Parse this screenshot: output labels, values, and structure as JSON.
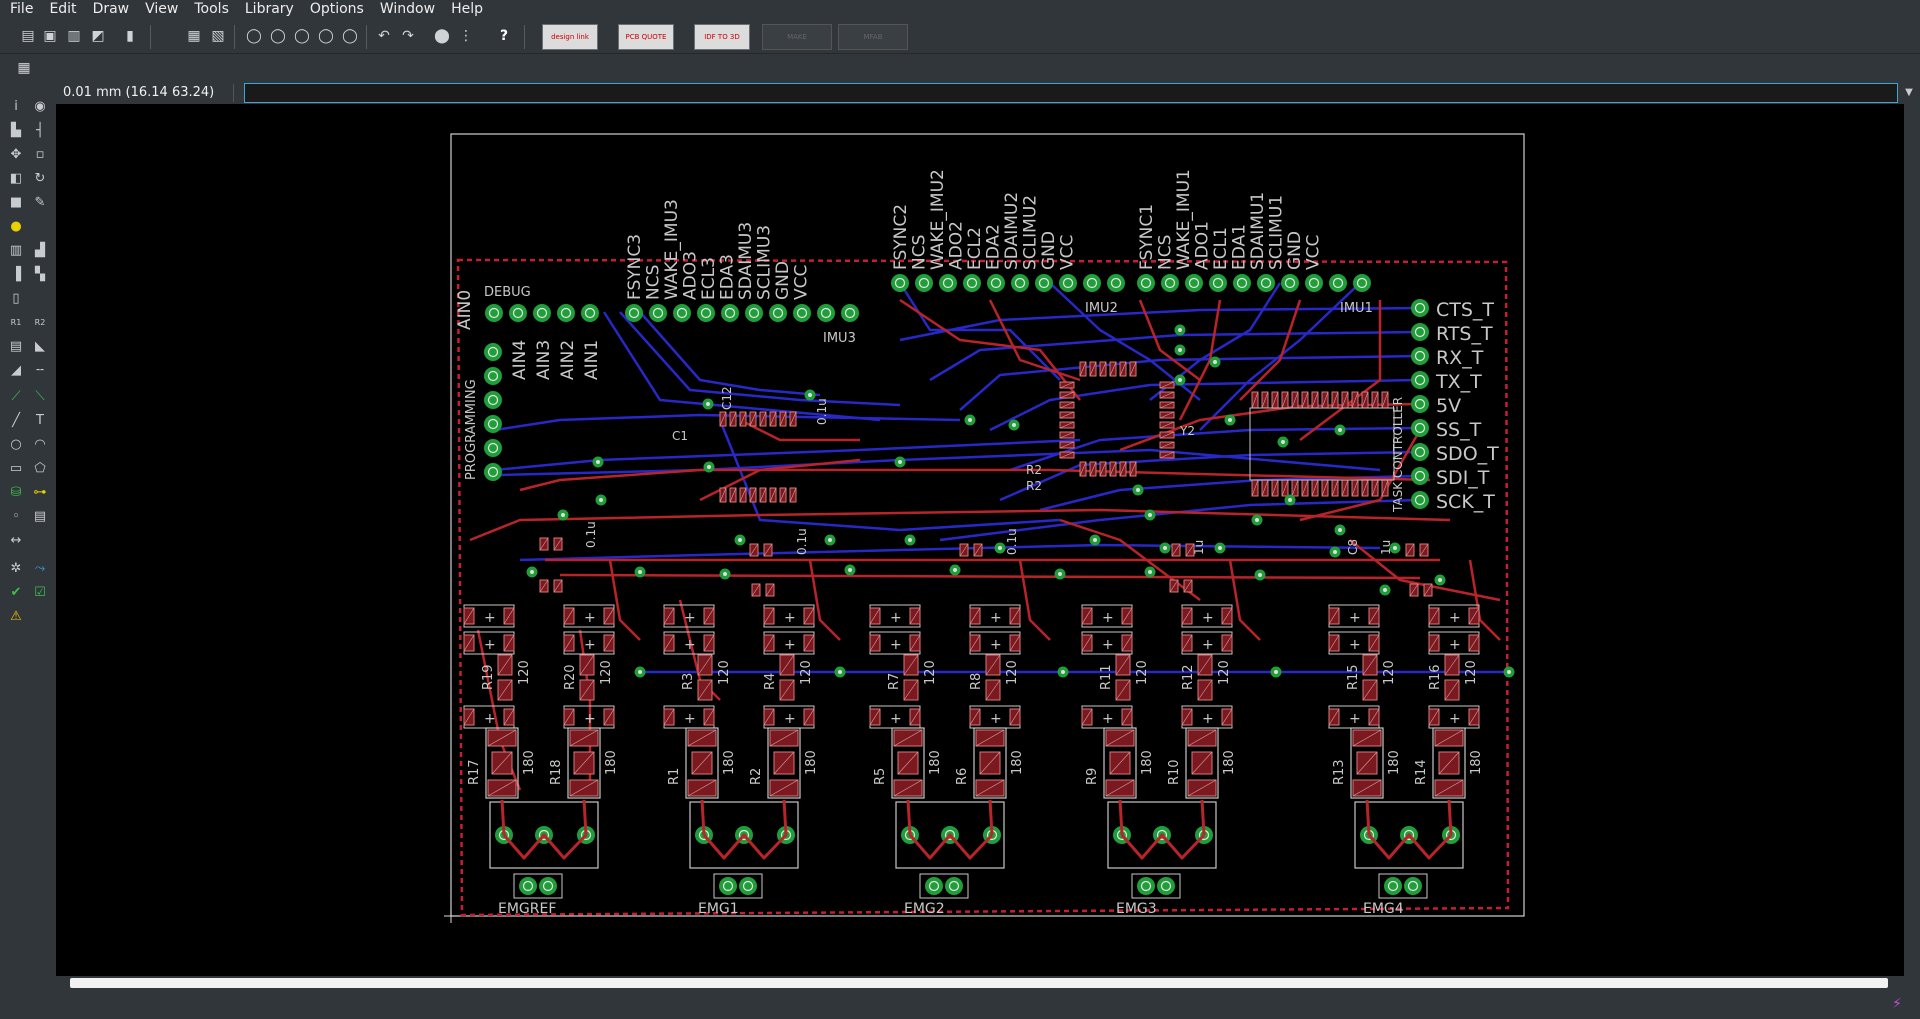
{
  "menu": [
    "File",
    "Edit",
    "Draw",
    "View",
    "Tools",
    "Library",
    "Options",
    "Window",
    "Help"
  ],
  "toolbar": {
    "design_link": "design link",
    "pcb_quote": "PCB QUOTE",
    "idf_to_3d": "IDF TO 3D",
    "make": "MAKE",
    "mfab": "MFAB"
  },
  "coordinate_readout": "0.01 mm (16.14 63.24)",
  "command_input": "",
  "board": {
    "header_pins_debug": [
      "AIN0",
      "AIN4",
      "AIN3",
      "AIN2",
      "AIN1"
    ],
    "debug_label": "DEBUG",
    "programming_label": "PROGRAMMING",
    "imu3_pins": [
      "FSYNC3",
      "NCS",
      "WAKE_IMU3",
      "ADO3",
      "ECL3",
      "EDA3",
      "SDAIMU3",
      "SCLIMU3",
      "GND",
      "VCC"
    ],
    "imu3_label": "IMU3",
    "imu2_pins": [
      "FSYNC2",
      "NCS",
      "WAKE_IMU2",
      "ADO2",
      "ECL2",
      "EDA2",
      "SDAIMU2",
      "SCLIMU2",
      "GND",
      "VCC"
    ],
    "imu2_label": "IMU2",
    "imu1_pins": [
      "FSYNC1",
      "NCS",
      "WAKE_IMU1",
      "ADO1",
      "ECL1",
      "EDA1",
      "SDAIMU1",
      "SCLIMU1",
      "GND",
      "VCC"
    ],
    "imu1_label": "IMU1",
    "task_pins": [
      "CTS_T",
      "RTS_T",
      "RX_T",
      "TX_T",
      "5V",
      "SS_T",
      "SDO_T",
      "SDI_T",
      "SCK_T"
    ],
    "task_label": "TASK CONTROLLER",
    "emg_groups": [
      {
        "label": "EMGREF",
        "r_top": [
          "R19",
          "R20"
        ],
        "r_bot": [
          "R17",
          "R18"
        ]
      },
      {
        "label": "EMG1",
        "r_top": [
          "R3",
          "R4"
        ],
        "r_bot": [
          "R1",
          "R2"
        ]
      },
      {
        "label": "EMG2",
        "r_top": [
          "R7",
          "R8"
        ],
        "r_bot": [
          "R5",
          "R6"
        ]
      },
      {
        "label": "EMG3",
        "r_top": [
          "R11",
          "R12"
        ],
        "r_bot": [
          "R9",
          "R10"
        ]
      },
      {
        "label": "EMG4",
        "r_top": [
          "R15",
          "R16"
        ],
        "r_bot": [
          "R13",
          "R14"
        ]
      }
    ],
    "r_top_value": "120",
    "r_bot_value": "180",
    "cap_labels": [
      "C12",
      "C1",
      "0.1u",
      "1u",
      "C8"
    ],
    "other_labels": [
      "R2",
      "R2",
      "Y2"
    ]
  },
  "colors": {
    "top_copper": "#b8242a",
    "bottom_copper": "#2828c8",
    "pad": "#1f9e3a",
    "silk": "#c8c8c8",
    "outline": "#d0d0d0",
    "keepout": "#c81e32"
  }
}
